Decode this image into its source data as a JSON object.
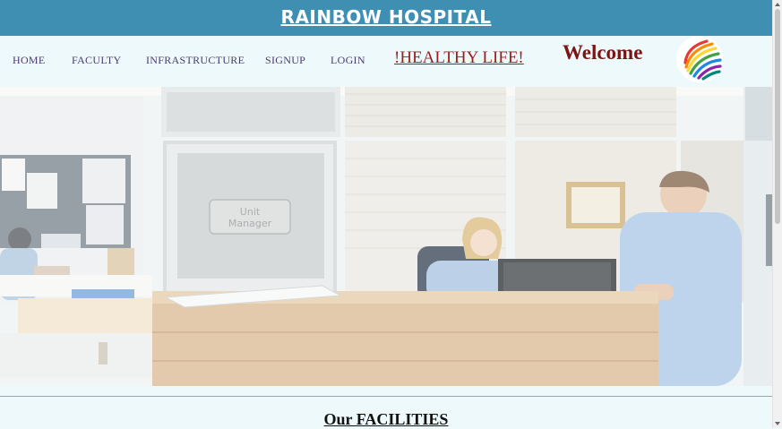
{
  "header": {
    "site_title": "RAINBOW HOSPITAL"
  },
  "nav": {
    "items": [
      "HOME",
      "FACULTY",
      "INFRASTRUCTURE",
      "SIGNUP",
      "LOGIN"
    ],
    "tagline": "!HEALTHY LIFE!",
    "welcome": "Welcome"
  },
  "hero": {
    "sign_text_line1": "Unit",
    "sign_text_line2": "Manager"
  },
  "section": {
    "facilities_title": "Our FACILITIES"
  },
  "colors": {
    "header_bg": "#3f8fb3",
    "page_bg": "#eef9fc",
    "tagline": "#9e1b1b",
    "welcome": "#7a1515",
    "nav_text": "#4a3b6e"
  },
  "icons": {
    "logo": "rainbow-swirl-logo"
  }
}
